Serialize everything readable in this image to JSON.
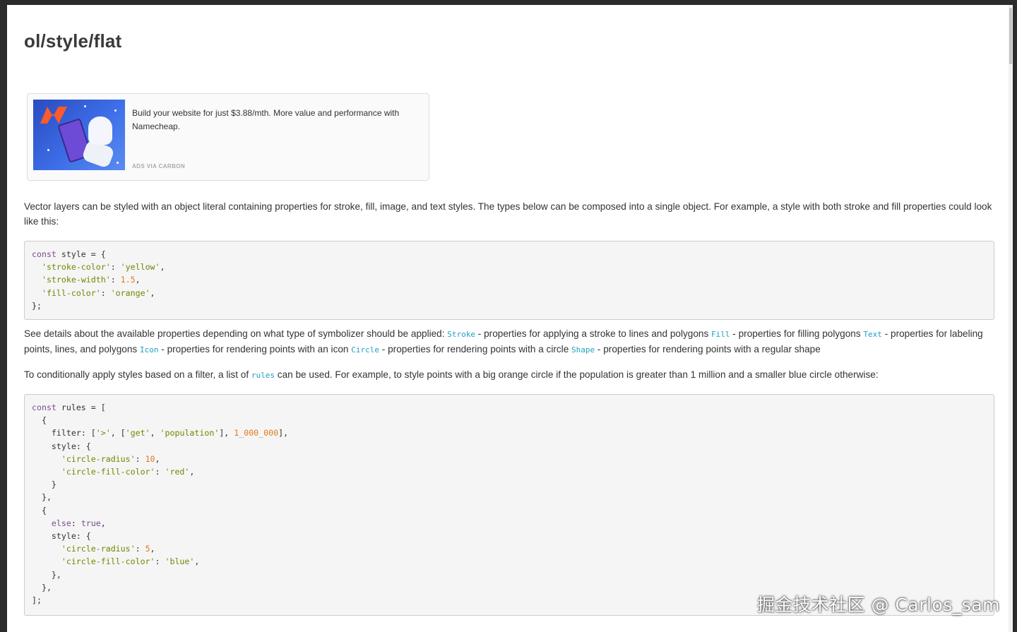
{
  "page": {
    "title": "ol/style/flat"
  },
  "ad": {
    "text": "Build your website for just $3.88/mth. More value and performance with Namecheap.",
    "via": "ADS VIA CARBON",
    "brand_color": "#ff5a2a",
    "image_icon": "namecheap-logo-icon"
  },
  "intro": {
    "text": "Vector layers can be styled with an object literal containing properties for stroke, fill, image, and text styles. The types below can be composed into a single object. For example, a style with both stroke and fill properties could look like this:"
  },
  "code1": {
    "l1_kw": "const",
    "l1_rest": " style = {",
    "l2_key": "'stroke-color'",
    "l2_val": "'yellow'",
    "l3_key": "'stroke-width'",
    "l3_val": "1.5",
    "l4_key": "'fill-color'",
    "l4_val": "'orange'",
    "l5": "};"
  },
  "details": {
    "intro": "See details about the available properties depending on what type of symbolizer should be applied: ",
    "items": [
      {
        "code": "Stroke",
        "desc": " - properties for applying a stroke to lines and polygons "
      },
      {
        "code": "Fill",
        "desc": " - properties for filling polygons "
      },
      {
        "code": "Text",
        "desc": " - properties for labeling points, lines, and polygons "
      },
      {
        "code": "Icon",
        "desc": " - properties for rendering points with an icon "
      },
      {
        "code": "Circle",
        "desc": " - properties for rendering points with a circle "
      },
      {
        "code": "Shape",
        "desc": " - properties for rendering points with a regular shape"
      }
    ]
  },
  "rules_para": {
    "before": "To conditionally apply styles based on a filter, a list of ",
    "code": "rules",
    "after": " can be used. For example, to style points with a big orange circle if the population is greater than 1 million and a smaller blue circle otherwise:"
  },
  "code2": {
    "kw_const": "const",
    "rules_decl": " rules = [",
    "filter_label": "filter",
    "filter_op": "'>'",
    "filter_get": "'get'",
    "filter_prop": "'population'",
    "filter_num": "1_000_000",
    "style_label": "style",
    "r1_key": "'circle-radius'",
    "r1_val": "10",
    "c1_key": "'circle-fill-color'",
    "c1_val": "'red'",
    "else_label": "else",
    "else_val": "true",
    "r2_key": "'circle-radius'",
    "r2_val": "5",
    "c2_key": "'circle-fill-color'",
    "c2_val": "'blue'",
    "end": "];"
  },
  "watermark": {
    "text": "掘金技术社区 @ Carlos_sam"
  },
  "colors": {
    "keyword": "#7a4d8c",
    "string": "#6a8a00",
    "number": "#e07a1a",
    "inline_code": "#1da1c4"
  }
}
